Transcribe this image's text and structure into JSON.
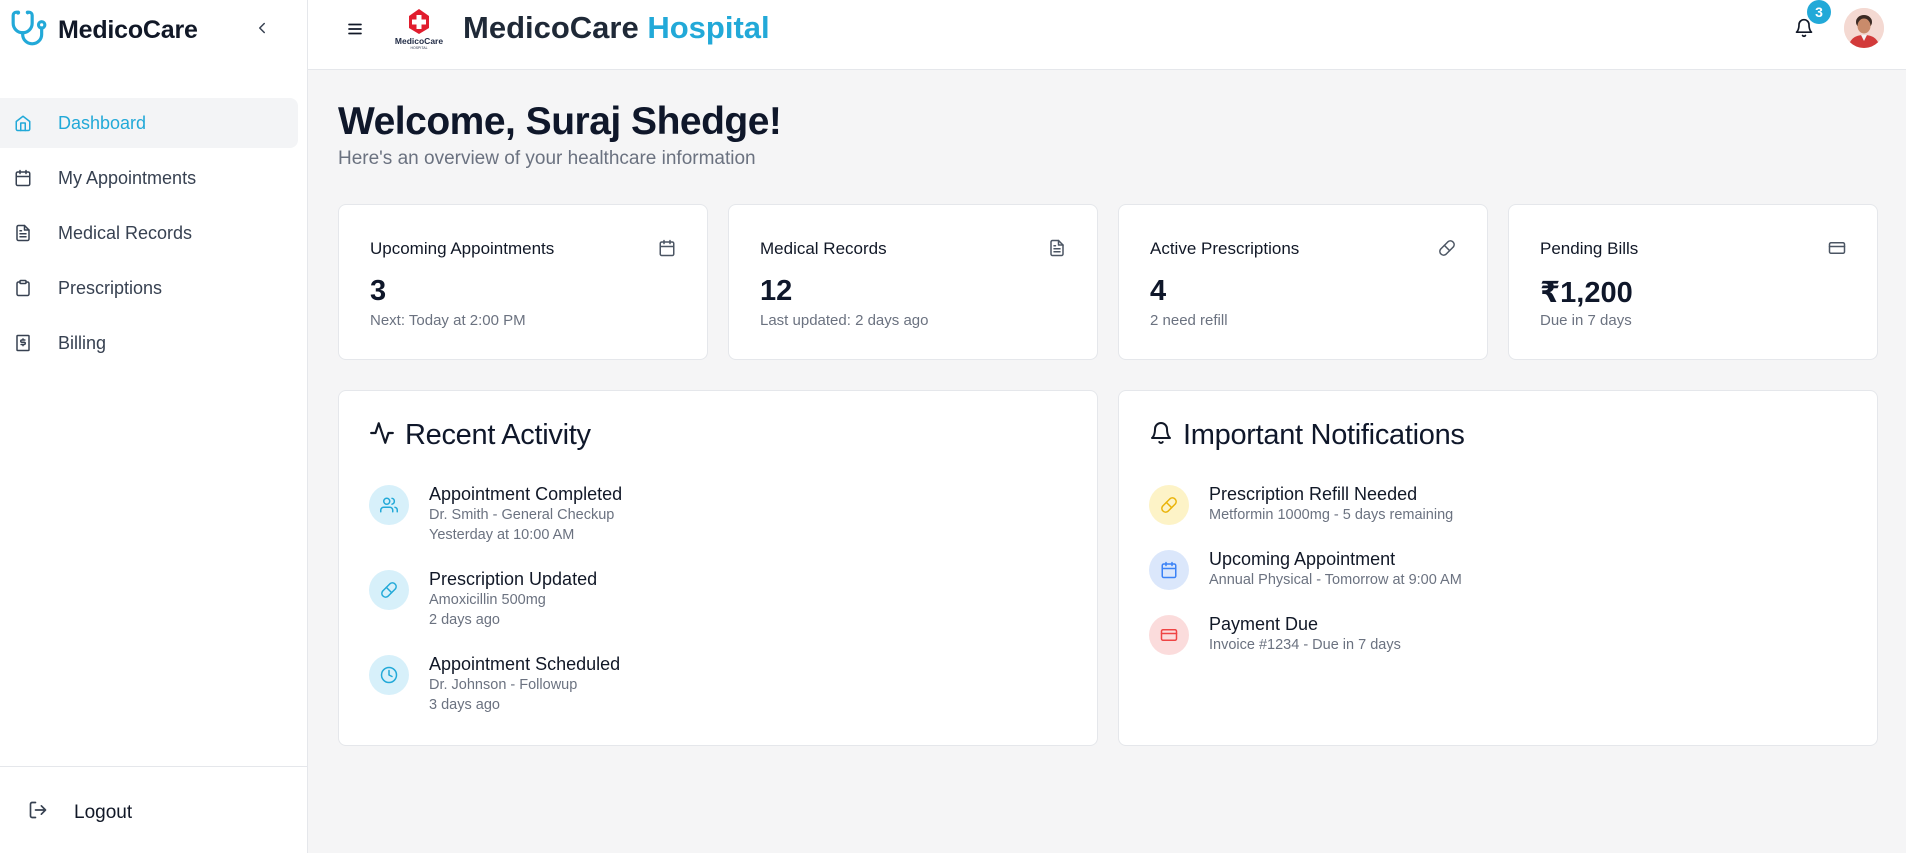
{
  "brand": {
    "name": "MedicoCare"
  },
  "nav": {
    "items": [
      {
        "label": "Dashboard",
        "icon": "home-icon",
        "active": true
      },
      {
        "label": "My Appointments",
        "icon": "calendar-icon"
      },
      {
        "label": "Medical Records",
        "icon": "file-text-icon"
      },
      {
        "label": "Prescriptions",
        "icon": "clipboard-icon"
      },
      {
        "label": "Billing",
        "icon": "receipt-icon"
      }
    ],
    "logout": "Logout"
  },
  "header": {
    "title_part1": "MedicoCare",
    "title_part2": "Hospital",
    "logo_text": "MedicoCare",
    "logo_subtext": "HOSPITAL",
    "notification_count": "3"
  },
  "welcome": {
    "title": "Welcome, Suraj Shedge!",
    "subtitle": "Here's an overview of your healthcare information"
  },
  "stats": [
    {
      "title": "Upcoming Appointments",
      "value": "3",
      "sub": "Next: Today at 2:00 PM",
      "icon": "calendar-icon"
    },
    {
      "title": "Medical Records",
      "value": "12",
      "sub": "Last updated: 2 days ago",
      "icon": "file-text-icon"
    },
    {
      "title": "Active Prescriptions",
      "value": "4",
      "sub": "2 need refill",
      "icon": "pill-icon"
    },
    {
      "title": "Pending Bills",
      "value": "₹1,200",
      "sub": "Due in 7 days",
      "icon": "credit-card-icon"
    }
  ],
  "recent_activity": {
    "title": "Recent Activity",
    "items": [
      {
        "title": "Appointment Completed",
        "line1": "Dr. Smith - General Checkup",
        "line2": "Yesterday at 10:00 AM",
        "icon": "users-icon"
      },
      {
        "title": "Prescription Updated",
        "line1": "Amoxicillin 500mg",
        "line2": "2 days ago",
        "icon": "pill-icon"
      },
      {
        "title": "Appointment Scheduled",
        "line1": "Dr. Johnson - Followup",
        "line2": "3 days ago",
        "icon": "clock-icon"
      }
    ]
  },
  "notifications": {
    "title": "Important Notifications",
    "items": [
      {
        "title": "Prescription Refill Needed",
        "line1": "Metformin 1000mg - 5 days remaining",
        "icon": "pill-icon",
        "color": "#eab308",
        "bg": "#fdf3c7"
      },
      {
        "title": "Upcoming Appointment",
        "line1": "Annual Physical - Tomorrow at 9:00 AM",
        "icon": "calendar-icon",
        "color": "#3b82f6",
        "bg": "#dbe7fb"
      },
      {
        "title": "Payment Due",
        "line1": "Invoice #1234 - Due in 7 days",
        "icon": "credit-card-icon",
        "color": "#ef4444",
        "bg": "#fbdcdc"
      }
    ]
  },
  "colors": {
    "accent": "#22a9d8",
    "activity_icon_bg": "#d7f0fa",
    "background": "#f5f5f6"
  }
}
